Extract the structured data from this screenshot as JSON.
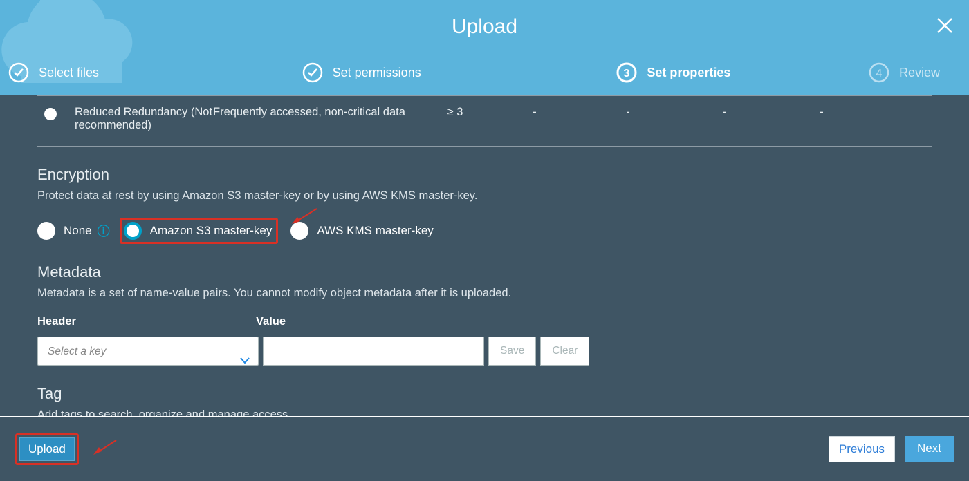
{
  "header": {
    "title": "Upload",
    "steps": [
      {
        "label": "Select files",
        "state": "done"
      },
      {
        "label": "Set permissions",
        "state": "done"
      },
      {
        "label": "Set properties",
        "state": "active",
        "number": "3"
      },
      {
        "label": "Review",
        "state": "pending",
        "number": "4"
      }
    ]
  },
  "storage_class_row": {
    "name": "Reduced Redundancy (Not recommended)",
    "designed_for": "Frequently accessed, non-critical data",
    "az": "≥ 3",
    "cols": [
      "-",
      "-",
      "-",
      "-"
    ]
  },
  "encryption": {
    "title": "Encryption",
    "desc": "Protect data at rest by using Amazon S3 master-key or by using AWS KMS master-key.",
    "options": {
      "none": "None",
      "s3": "Amazon S3 master-key",
      "kms": "AWS KMS master-key"
    }
  },
  "metadata": {
    "title": "Metadata",
    "desc": "Metadata is a set of name-value pairs. You cannot modify object metadata after it is uploaded.",
    "header_label": "Header",
    "value_label": "Value",
    "select_placeholder": "Select a key",
    "save_label": "Save",
    "clear_label": "Clear"
  },
  "tag": {
    "title": "Tag",
    "desc": "Add tags to search, organize and manage access."
  },
  "footer": {
    "upload_label": "Upload",
    "previous_label": "Previous",
    "next_label": "Next"
  }
}
